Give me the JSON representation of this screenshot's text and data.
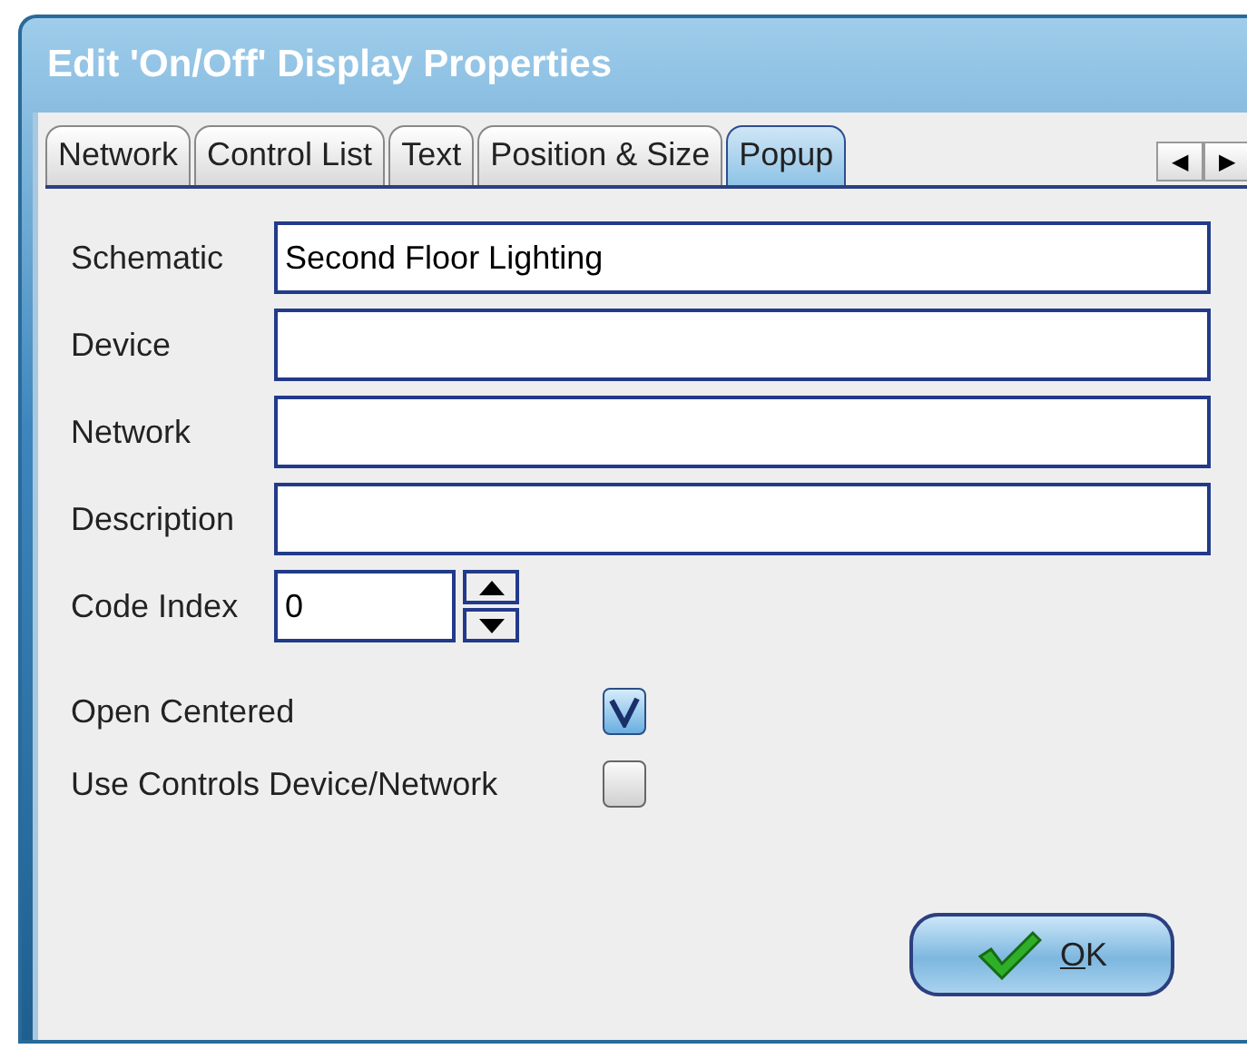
{
  "window": {
    "title": "Edit 'On/Off' Display Properties"
  },
  "tabs": [
    {
      "label": "Network",
      "selected": false
    },
    {
      "label": "Control List",
      "selected": false
    },
    {
      "label": "Text",
      "selected": false
    },
    {
      "label": "Position & Size",
      "selected": false
    },
    {
      "label": "Popup",
      "selected": true
    }
  ],
  "tab_scroll": [
    "◀",
    "▶"
  ],
  "fields": [
    {
      "label": "Schematic",
      "value": "Second Floor Lighting"
    },
    {
      "label": "Device"
    },
    {
      "label": "Network"
    },
    {
      "label": "Description"
    }
  ],
  "code_index": {
    "label": "Code Index",
    "value": "0"
  },
  "checkboxes": [
    {
      "label": "Open Centered",
      "checked": true
    },
    {
      "label": "Use Controls Device/Network",
      "checked": false
    }
  ],
  "ok_button": {
    "label": "OK"
  }
}
